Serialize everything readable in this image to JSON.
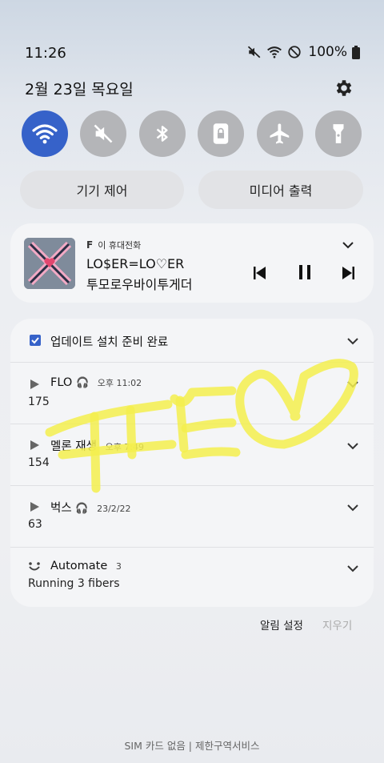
{
  "status_bar": {
    "time": "11:26",
    "battery": "100%"
  },
  "header": {
    "date": "2월 23일 목요일"
  },
  "quick_settings": [
    {
      "icon": "wifi-icon",
      "active": true
    },
    {
      "icon": "mute-icon",
      "active": false
    },
    {
      "icon": "bluetooth-icon",
      "active": false
    },
    {
      "icon": "lock-icon",
      "active": false
    },
    {
      "icon": "airplane-icon",
      "active": false
    },
    {
      "icon": "flashlight-icon",
      "active": false
    }
  ],
  "pills": {
    "device_control": "기기 제어",
    "media_output": "미디어 출력"
  },
  "media": {
    "source_label": "이 휴대전화",
    "title": "LO$ER=LO♡ER",
    "artist": "투모로우바이투게더"
  },
  "notifications": [
    {
      "title": "업데이트 설치 준비 완료",
      "time": "",
      "subtitle": ""
    },
    {
      "title": "FLO",
      "time": "오후 11:02",
      "subtitle": "175"
    },
    {
      "title": "멜론 재생",
      "time": "오후 7:49",
      "subtitle": "154"
    },
    {
      "title": "벅스",
      "time": "23/2/22",
      "subtitle": "63"
    },
    {
      "title": "Automate",
      "count": "3",
      "subtitle": "Running 3 fibers"
    }
  ],
  "actions": {
    "notification_settings": "알림 설정",
    "clear": "지우기"
  },
  "footer": {
    "sim_status": "SIM 카드 없음 | 제한구역서비스"
  },
  "colors": {
    "accent": "#3662c9",
    "qs_inactive": "#b4b5b8",
    "doodle": "#f3ef4e"
  }
}
